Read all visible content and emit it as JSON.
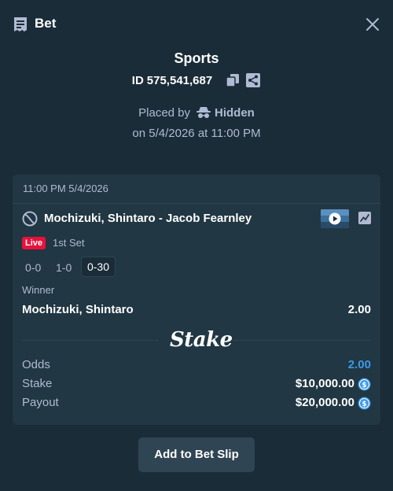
{
  "header": {
    "title": "Bet",
    "icon": "receipt-icon"
  },
  "bet": {
    "category": "Sports",
    "id_prefix": "ID",
    "id": "575,541,687",
    "placed_by_label": "Placed by",
    "placed_by_user": "Hidden",
    "placed_on": "on 5/4/2026 at 11:00 PM"
  },
  "card": {
    "time": "11:00 PM 5/4/2026",
    "match": "Mochizuki, Shintaro - Jacob Fearnley",
    "live_label": "Live",
    "period": "1st Set",
    "scores": [
      "0-0",
      "1-0",
      "0-30"
    ],
    "market": "Winner",
    "selection": "Mochizuki, Shintaro",
    "selection_odds": "2.00",
    "brand": "Stake",
    "odds_label": "Odds",
    "odds_value": "2.00",
    "stake_label": "Stake",
    "stake_value": "$10,000.00",
    "payout_label": "Payout",
    "payout_value": "$20,000.00"
  },
  "actions": {
    "add_label": "Add to Bet Slip"
  },
  "colors": {
    "background": "#1a2c38",
    "card": "#213743",
    "accent_blue": "#3d99e9",
    "live_red": "#e9113c",
    "button": "#2f4553"
  }
}
